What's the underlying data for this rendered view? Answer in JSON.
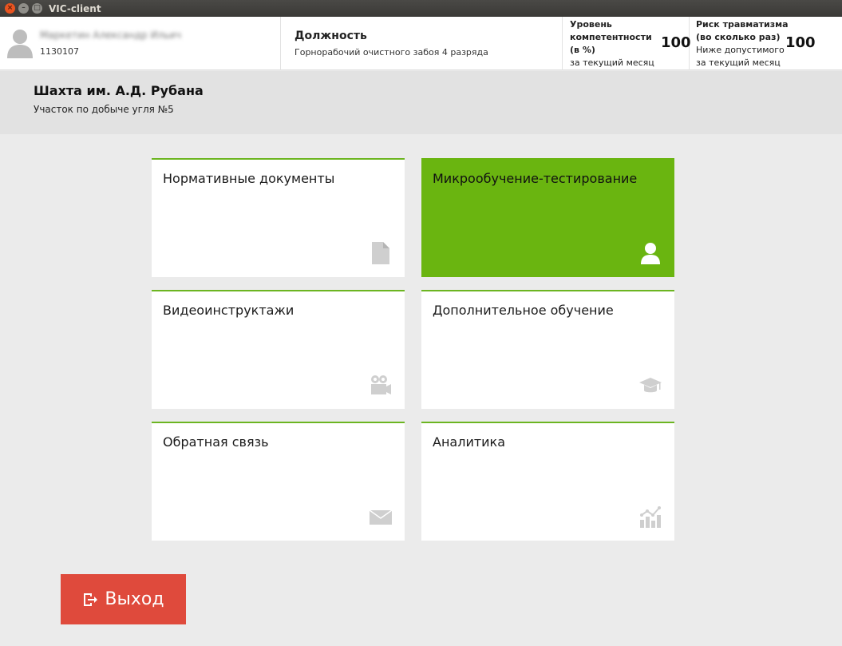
{
  "window": {
    "title": "VIC-client",
    "buttons": {
      "close": "×",
      "minimize": "–",
      "maximize": "□"
    }
  },
  "header": {
    "user": {
      "name": "Маркетин Александр Ильич",
      "id": "1130107",
      "icon": "user-avatar-icon"
    },
    "position": {
      "label": "Должность",
      "value": "Горнорабочий очистного забоя 4 разряда"
    },
    "competence": {
      "line1": "Уровень",
      "line2": "компетентности",
      "line3": "(в %)",
      "line4": "за текущий месяц",
      "value": "100"
    },
    "risk": {
      "line1": "Риск травматизма",
      "line2": "(во сколько раз)",
      "line3": "Ниже допустимого",
      "line4": "за текущий месяц",
      "value": "100"
    }
  },
  "location": {
    "mine": "Шахта им. А.Д. Рубана",
    "section": "Участок по добыче угля №5"
  },
  "tiles": [
    {
      "label": "Нормативные документы",
      "icon": "document-icon",
      "active": false
    },
    {
      "label": "Микрообучение-тестирование",
      "icon": "user-icon",
      "active": true
    },
    {
      "label": "Видеоинструктажи",
      "icon": "video-camera-icon",
      "active": false
    },
    {
      "label": "Дополнительное обучение",
      "icon": "graduation-cap-icon",
      "active": false
    },
    {
      "label": "Обратная связь",
      "icon": "envelope-icon",
      "active": false
    },
    {
      "label": "Аналитика",
      "icon": "analytics-chart-icon",
      "active": false
    }
  ],
  "exit": {
    "label": "Выход",
    "icon": "exit-icon"
  },
  "colors": {
    "accent_green": "#6ab510",
    "exit_red": "#df4a3c",
    "background": "#ebebeb",
    "icon_gray": "#c8c8c8"
  }
}
